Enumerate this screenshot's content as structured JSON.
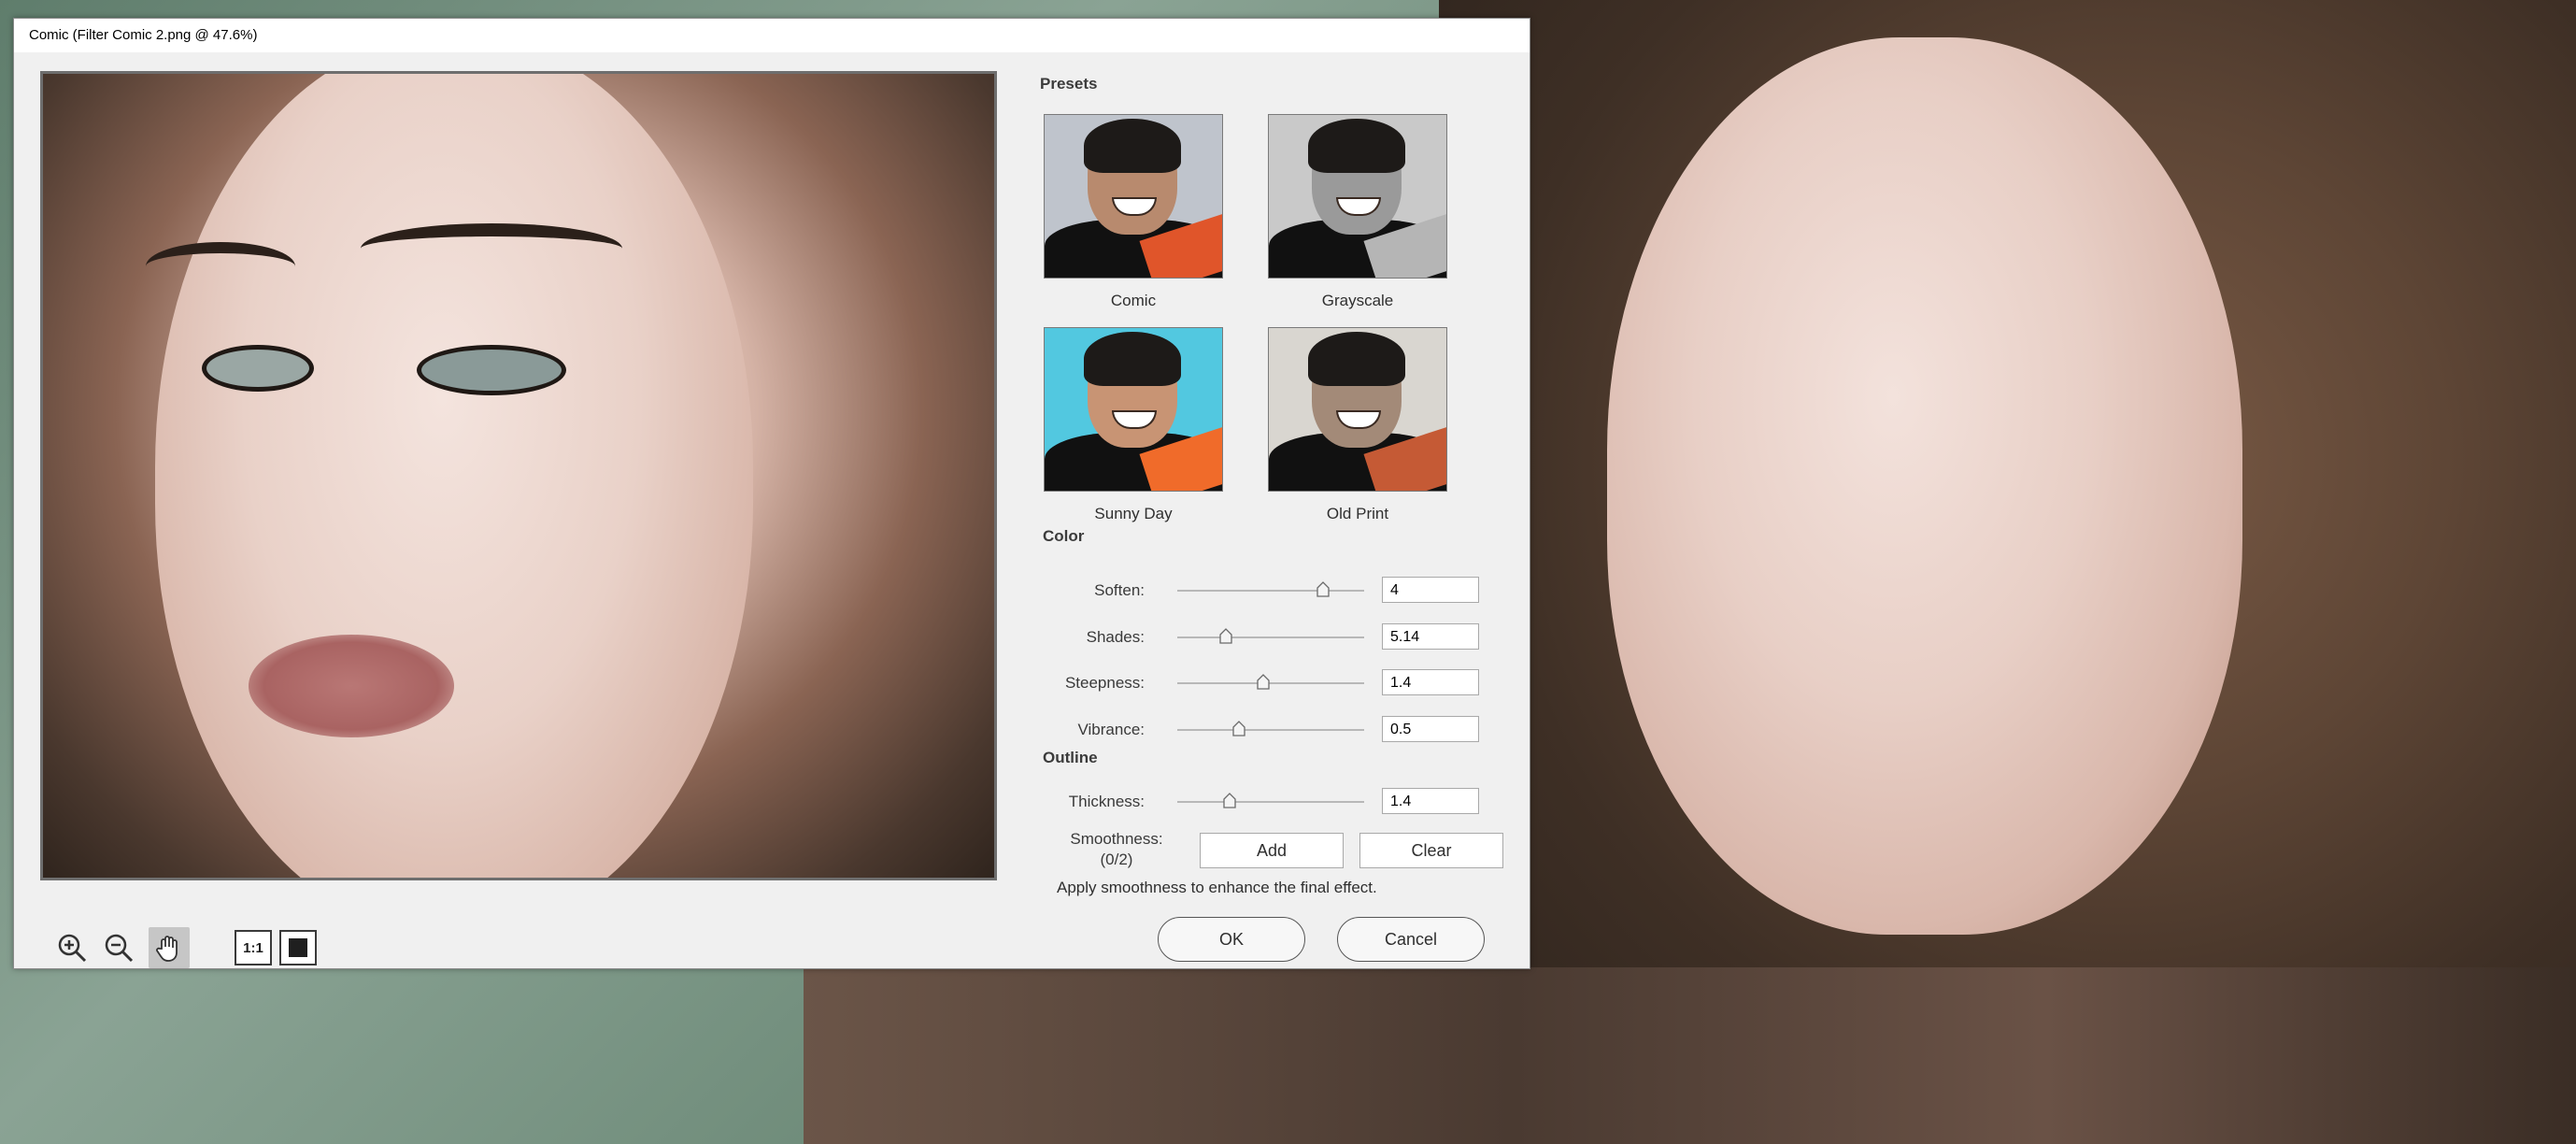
{
  "window": {
    "title": "Comic (Filter Comic 2.png @ 47.6%)"
  },
  "presets": {
    "heading": "Presets",
    "items": [
      {
        "label": "Comic",
        "bg": "#bfc4cc",
        "skin": "#b88a6e",
        "board": "#e0552a"
      },
      {
        "label": "Grayscale",
        "bg": "#c9c9c9",
        "skin": "#9a9a9a",
        "board": "#b5b5b5"
      },
      {
        "label": "Sunny Day",
        "bg": "#52c8e0",
        "skin": "#c89474",
        "board": "#f06b2a"
      },
      {
        "label": "Old Print",
        "bg": "#d9d6d0",
        "skin": "#a38a78",
        "board": "#c55a35"
      }
    ]
  },
  "color": {
    "heading": "Color",
    "sliders": [
      {
        "label": "Soften:",
        "value": "4",
        "fraction": 0.78
      },
      {
        "label": "Shades:",
        "value": "5.14",
        "fraction": 0.26
      },
      {
        "label": "Steepness:",
        "value": "1.4",
        "fraction": 0.46
      },
      {
        "label": "Vibrance:",
        "value": "0.5",
        "fraction": 0.33
      }
    ]
  },
  "outline": {
    "heading": "Outline",
    "thickness": {
      "label": "Thickness:",
      "value": "1.4",
      "fraction": 0.28
    },
    "smoothness": {
      "label": "Smoothness:",
      "count": "(0/2)"
    },
    "add_label": "Add",
    "clear_label": "Clear",
    "hint": "Apply smoothness to enhance the final effect."
  },
  "view_tools": {
    "ratio_label": "1:1"
  },
  "actions": {
    "ok_label": "OK",
    "cancel_label": "Cancel"
  },
  "colors": {
    "dialog_bg": "#f0f0f0",
    "preview_border": "#6e6e6e",
    "active_tool": "#c6c6c6"
  }
}
